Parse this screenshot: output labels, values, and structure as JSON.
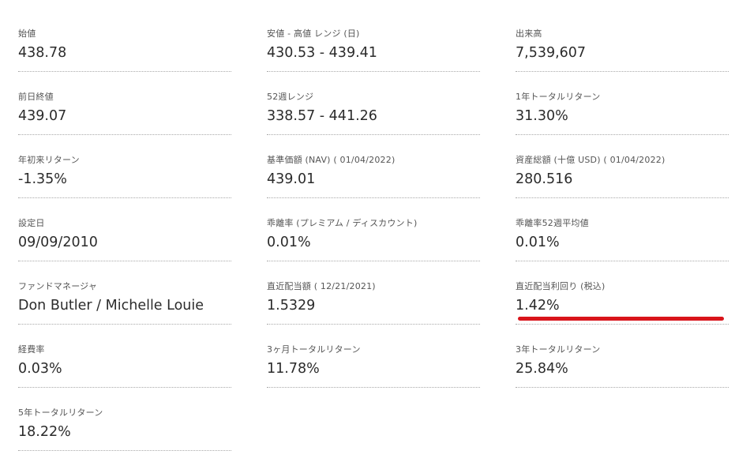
{
  "fields": [
    {
      "label": "始値",
      "value": "438.78"
    },
    {
      "label": "安値 - 高値 レンジ (日)",
      "value": "430.53 - 439.41"
    },
    {
      "label": "出来高",
      "value": "7,539,607"
    },
    {
      "label": "前日終値",
      "value": "439.07"
    },
    {
      "label": "52週レンジ",
      "value": "338.57 - 441.26"
    },
    {
      "label": "1年トータルリターン",
      "value": "31.30%"
    },
    {
      "label": "年初来リターン",
      "value": "-1.35%"
    },
    {
      "label": "基準価額 (NAV) ( 01/04/2022)",
      "value": "439.01"
    },
    {
      "label": "資産総額 (十億 USD) ( 01/04/2022)",
      "value": "280.516"
    },
    {
      "label": "設定日",
      "value": "09/09/2010"
    },
    {
      "label": "乖離率 (プレミアム / ディスカウント)",
      "value": "0.01%"
    },
    {
      "label": "乖離率52週平均値",
      "value": "0.01%"
    },
    {
      "label": "ファンドマネージャ",
      "value": "Don Butler / Michelle Louie"
    },
    {
      "label": "直近配当額 ( 12/21/2021)",
      "value": "1.5329"
    },
    {
      "label": "直近配当利回り (税込)",
      "value": "1.42%"
    },
    {
      "label": "経費率",
      "value": "0.03%"
    },
    {
      "label": "3ヶ月トータルリターン",
      "value": "11.78%"
    },
    {
      "label": "3年トータルリターン",
      "value": "25.84%"
    },
    {
      "label": "5年トータルリターン",
      "value": "18.22%"
    }
  ],
  "highlight_color": "#d9141b"
}
